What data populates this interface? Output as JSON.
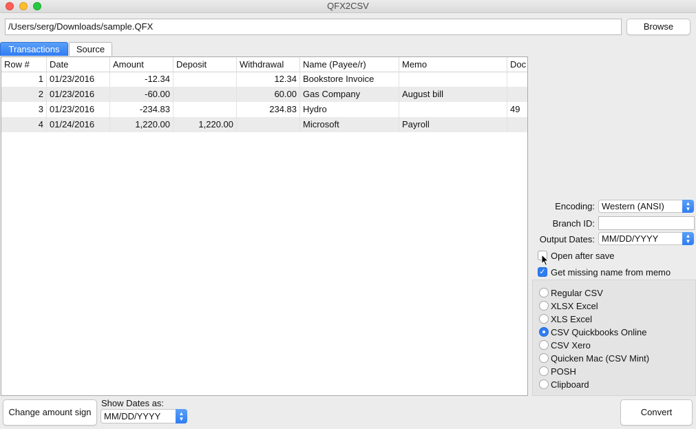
{
  "window": {
    "title": "QFX2CSV"
  },
  "file": {
    "path": "/Users/serg/Downloads/sample.QFX",
    "browse_label": "Browse"
  },
  "tabs": [
    {
      "label": "Transactions",
      "active": true
    },
    {
      "label": "Source",
      "active": false
    }
  ],
  "table": {
    "columns": [
      "Row #",
      "Date",
      "Amount",
      "Deposit",
      "Withdrawal",
      "Name (Payee/r)",
      "Memo",
      "Doc"
    ],
    "rows": [
      {
        "row": "1",
        "date": "01/23/2016",
        "amount": "-12.34",
        "deposit": "",
        "withdrawal": "12.34",
        "name": "Bookstore Invoice",
        "memo": "",
        "doc": ""
      },
      {
        "row": "2",
        "date": "01/23/2016",
        "amount": "-60.00",
        "deposit": "",
        "withdrawal": "60.00",
        "name": "Gas Company",
        "memo": "August bill",
        "doc": ""
      },
      {
        "row": "3",
        "date": "01/23/2016",
        "amount": "-234.83",
        "deposit": "",
        "withdrawal": "234.83",
        "name": "Hydro",
        "memo": "",
        "doc": "49"
      },
      {
        "row": "4",
        "date": "01/24/2016",
        "amount": "1,220.00",
        "deposit": "1,220.00",
        "withdrawal": "",
        "name": "Microsoft",
        "memo": "Payroll",
        "doc": ""
      }
    ]
  },
  "settings": {
    "encoding_label": "Encoding:",
    "encoding_value": "Western (ANSI)",
    "branch_label": "Branch ID:",
    "branch_value": "",
    "output_dates_label": "Output Dates:",
    "output_dates_value": "MM/DD/YYYY",
    "open_after_save_label": "Open after save",
    "open_after_save_checked": false,
    "missing_name_label": "Get missing name from memo",
    "missing_name_checked": true
  },
  "formats": {
    "options": [
      "Regular CSV",
      "XLSX Excel",
      "XLS Excel",
      "CSV Quickbooks Online",
      "CSV Xero",
      "Quicken Mac (CSV Mint)",
      "POSH",
      "Clipboard"
    ],
    "selected": "CSV Quickbooks Online"
  },
  "bottom": {
    "change_sign_label": "Change amount sign",
    "show_dates_label": "Show Dates as:",
    "show_dates_value": "MM/DD/YYYY",
    "convert_label": "Convert"
  },
  "colors": {
    "accent": "#2f7cf3",
    "row_alt": "#ebebeb"
  }
}
